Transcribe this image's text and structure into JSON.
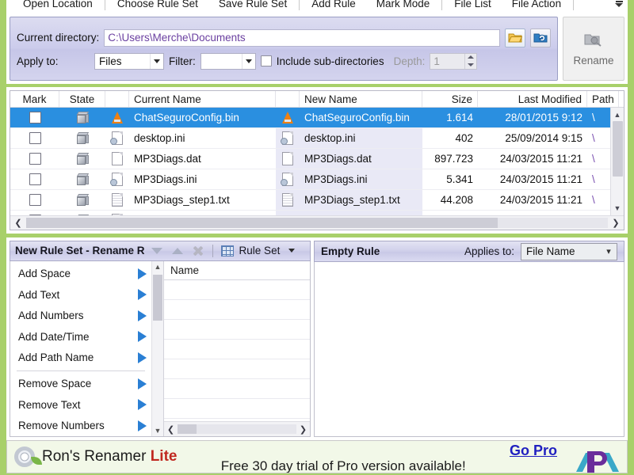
{
  "app": {
    "name": "Ron's Renamer",
    "edition": "Lite"
  },
  "menubar": {
    "items": [
      {
        "label": "Open Location",
        "sep_after": true
      },
      {
        "label": "Choose Rule Set",
        "sep_after": false
      },
      {
        "label": "Save Rule Set",
        "sep_after": true
      },
      {
        "label": "Add Rule",
        "sep_after": false
      },
      {
        "label": "Mark Mode",
        "sep_after": true
      },
      {
        "label": "File List",
        "sep_after": false
      },
      {
        "label": "File Action",
        "sep_after": true
      }
    ],
    "overflow_icon": "overflow-chevron-icon"
  },
  "ribbon": {
    "current_directory_label": "Current directory:",
    "current_directory_value": "C:\\Users\\Merche\\Documents",
    "browse_icon": "folder-open-icon",
    "refresh_icon": "refresh-folder-icon",
    "apply_to_label": "Apply to:",
    "apply_to_value": "Files",
    "filter_label": "Filter:",
    "filter_value": "",
    "include_subdirs_label": "Include sub-directories",
    "include_subdirs_checked": false,
    "depth_label": "Depth:",
    "depth_value": "1",
    "rename_label": "Rename",
    "rename_icon": "rename-icon"
  },
  "filelist": {
    "columns": [
      "Mark",
      "State",
      "Current Name",
      "New Name",
      "Size",
      "Last Modified",
      "Path"
    ],
    "rows": [
      {
        "marked": false,
        "state_icon": "cube-icon",
        "current_icon": "vlc-cone-icon",
        "current_name": "ChatSeguroConfig.bin",
        "new_icon": "vlc-cone-icon",
        "new_name": "ChatSeguroConfig.bin",
        "size": "1.614",
        "last_modified": "28/01/2015 9:12",
        "path": "\\",
        "selected": true
      },
      {
        "marked": false,
        "state_icon": "cube-icon",
        "current_icon": "ini-file-icon",
        "current_name": "desktop.ini",
        "new_icon": "ini-file-icon",
        "new_name": "desktop.ini",
        "size": "402",
        "last_modified": "25/09/2014 9:15",
        "path": "\\",
        "selected": false
      },
      {
        "marked": false,
        "state_icon": "cube-icon",
        "current_icon": "blank-file-icon",
        "current_name": "MP3Diags.dat",
        "new_icon": "blank-file-icon",
        "new_name": "MP3Diags.dat",
        "size": "897.723",
        "last_modified": "24/03/2015 11:21",
        "path": "\\",
        "selected": false
      },
      {
        "marked": false,
        "state_icon": "cube-icon",
        "current_icon": "ini-file-icon",
        "current_name": "MP3Diags.ini",
        "new_icon": "ini-file-icon",
        "new_name": "MP3Diags.ini",
        "size": "5.341",
        "last_modified": "24/03/2015 11:21",
        "path": "\\",
        "selected": false
      },
      {
        "marked": false,
        "state_icon": "cube-icon",
        "current_icon": "text-file-icon",
        "current_name": "MP3Diags_step1.txt",
        "new_icon": "text-file-icon",
        "new_name": "MP3Diags_step1.txt",
        "size": "44.208",
        "last_modified": "24/03/2015 11:21",
        "path": "\\",
        "selected": false
      }
    ]
  },
  "ruleset_panel": {
    "title": "New Rule Set - Rename R",
    "move_down_icon": "chevron-down-icon",
    "move_up_icon": "chevron-up-icon",
    "delete_icon": "delete-x-icon",
    "ruleset_button_label": "Rule Set",
    "ruleset_button_icon": "ruleset-grid-icon",
    "rules": [
      {
        "label": "Add Space",
        "divider_after": false
      },
      {
        "label": "Add Text",
        "divider_after": false
      },
      {
        "label": "Add Numbers",
        "divider_after": false
      },
      {
        "label": "Add Date/Time",
        "divider_after": false
      },
      {
        "label": "Add Path Name",
        "divider_after": true
      },
      {
        "label": "Remove Space",
        "divider_after": false
      },
      {
        "label": "Remove Text",
        "divider_after": false
      },
      {
        "label": "Remove Numbers",
        "divider_after": false
      }
    ],
    "name_grid_header": "Name"
  },
  "rule_editor": {
    "title": "Empty Rule",
    "applies_to_label": "Applies to:",
    "applies_to_value": "File Name"
  },
  "adbar": {
    "gear_icon": "app-gear-icon",
    "title": "Ron's Renamer",
    "edition": "Lite",
    "trial_text": "Free 30 day trial of Pro version available!",
    "go_pro_label": "Go Pro",
    "logo_icon": "rp-logo-icon"
  },
  "colors": {
    "selection_blue": "#2a8fe0",
    "chrome_green": "#a8d06a",
    "ribbon_lavender": "#ccccec",
    "path_purple": "#7a4fb0",
    "link_blue": "#2020c0",
    "lite_red": "#c0281f"
  }
}
